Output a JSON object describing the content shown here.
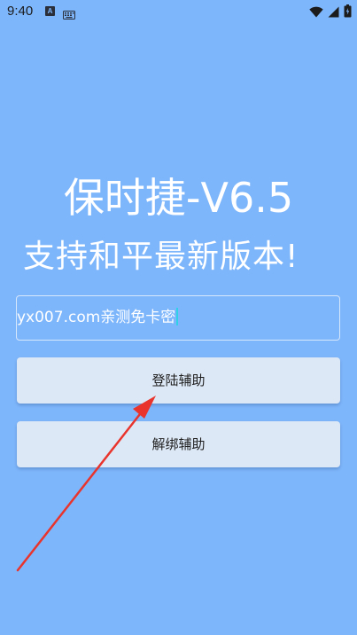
{
  "status_bar": {
    "time": "9:40",
    "a_icon_label": "A",
    "icons": [
      "a-notification-icon",
      "keyboard-icon",
      "wifi-icon",
      "signal-icon",
      "battery-icon"
    ]
  },
  "header": {
    "title": "保时捷-V6.5",
    "subtitle": "支持和平最新版本!"
  },
  "form": {
    "key_value": "yx007.com亲测免卡密"
  },
  "buttons": {
    "login_label": "登陆辅助",
    "unbind_label": "解绑辅助"
  },
  "colors": {
    "background": "#7eb6fb",
    "button_bg": "#dde8f6",
    "arrow": "#e8342c",
    "cursor": "#31d1e8"
  }
}
